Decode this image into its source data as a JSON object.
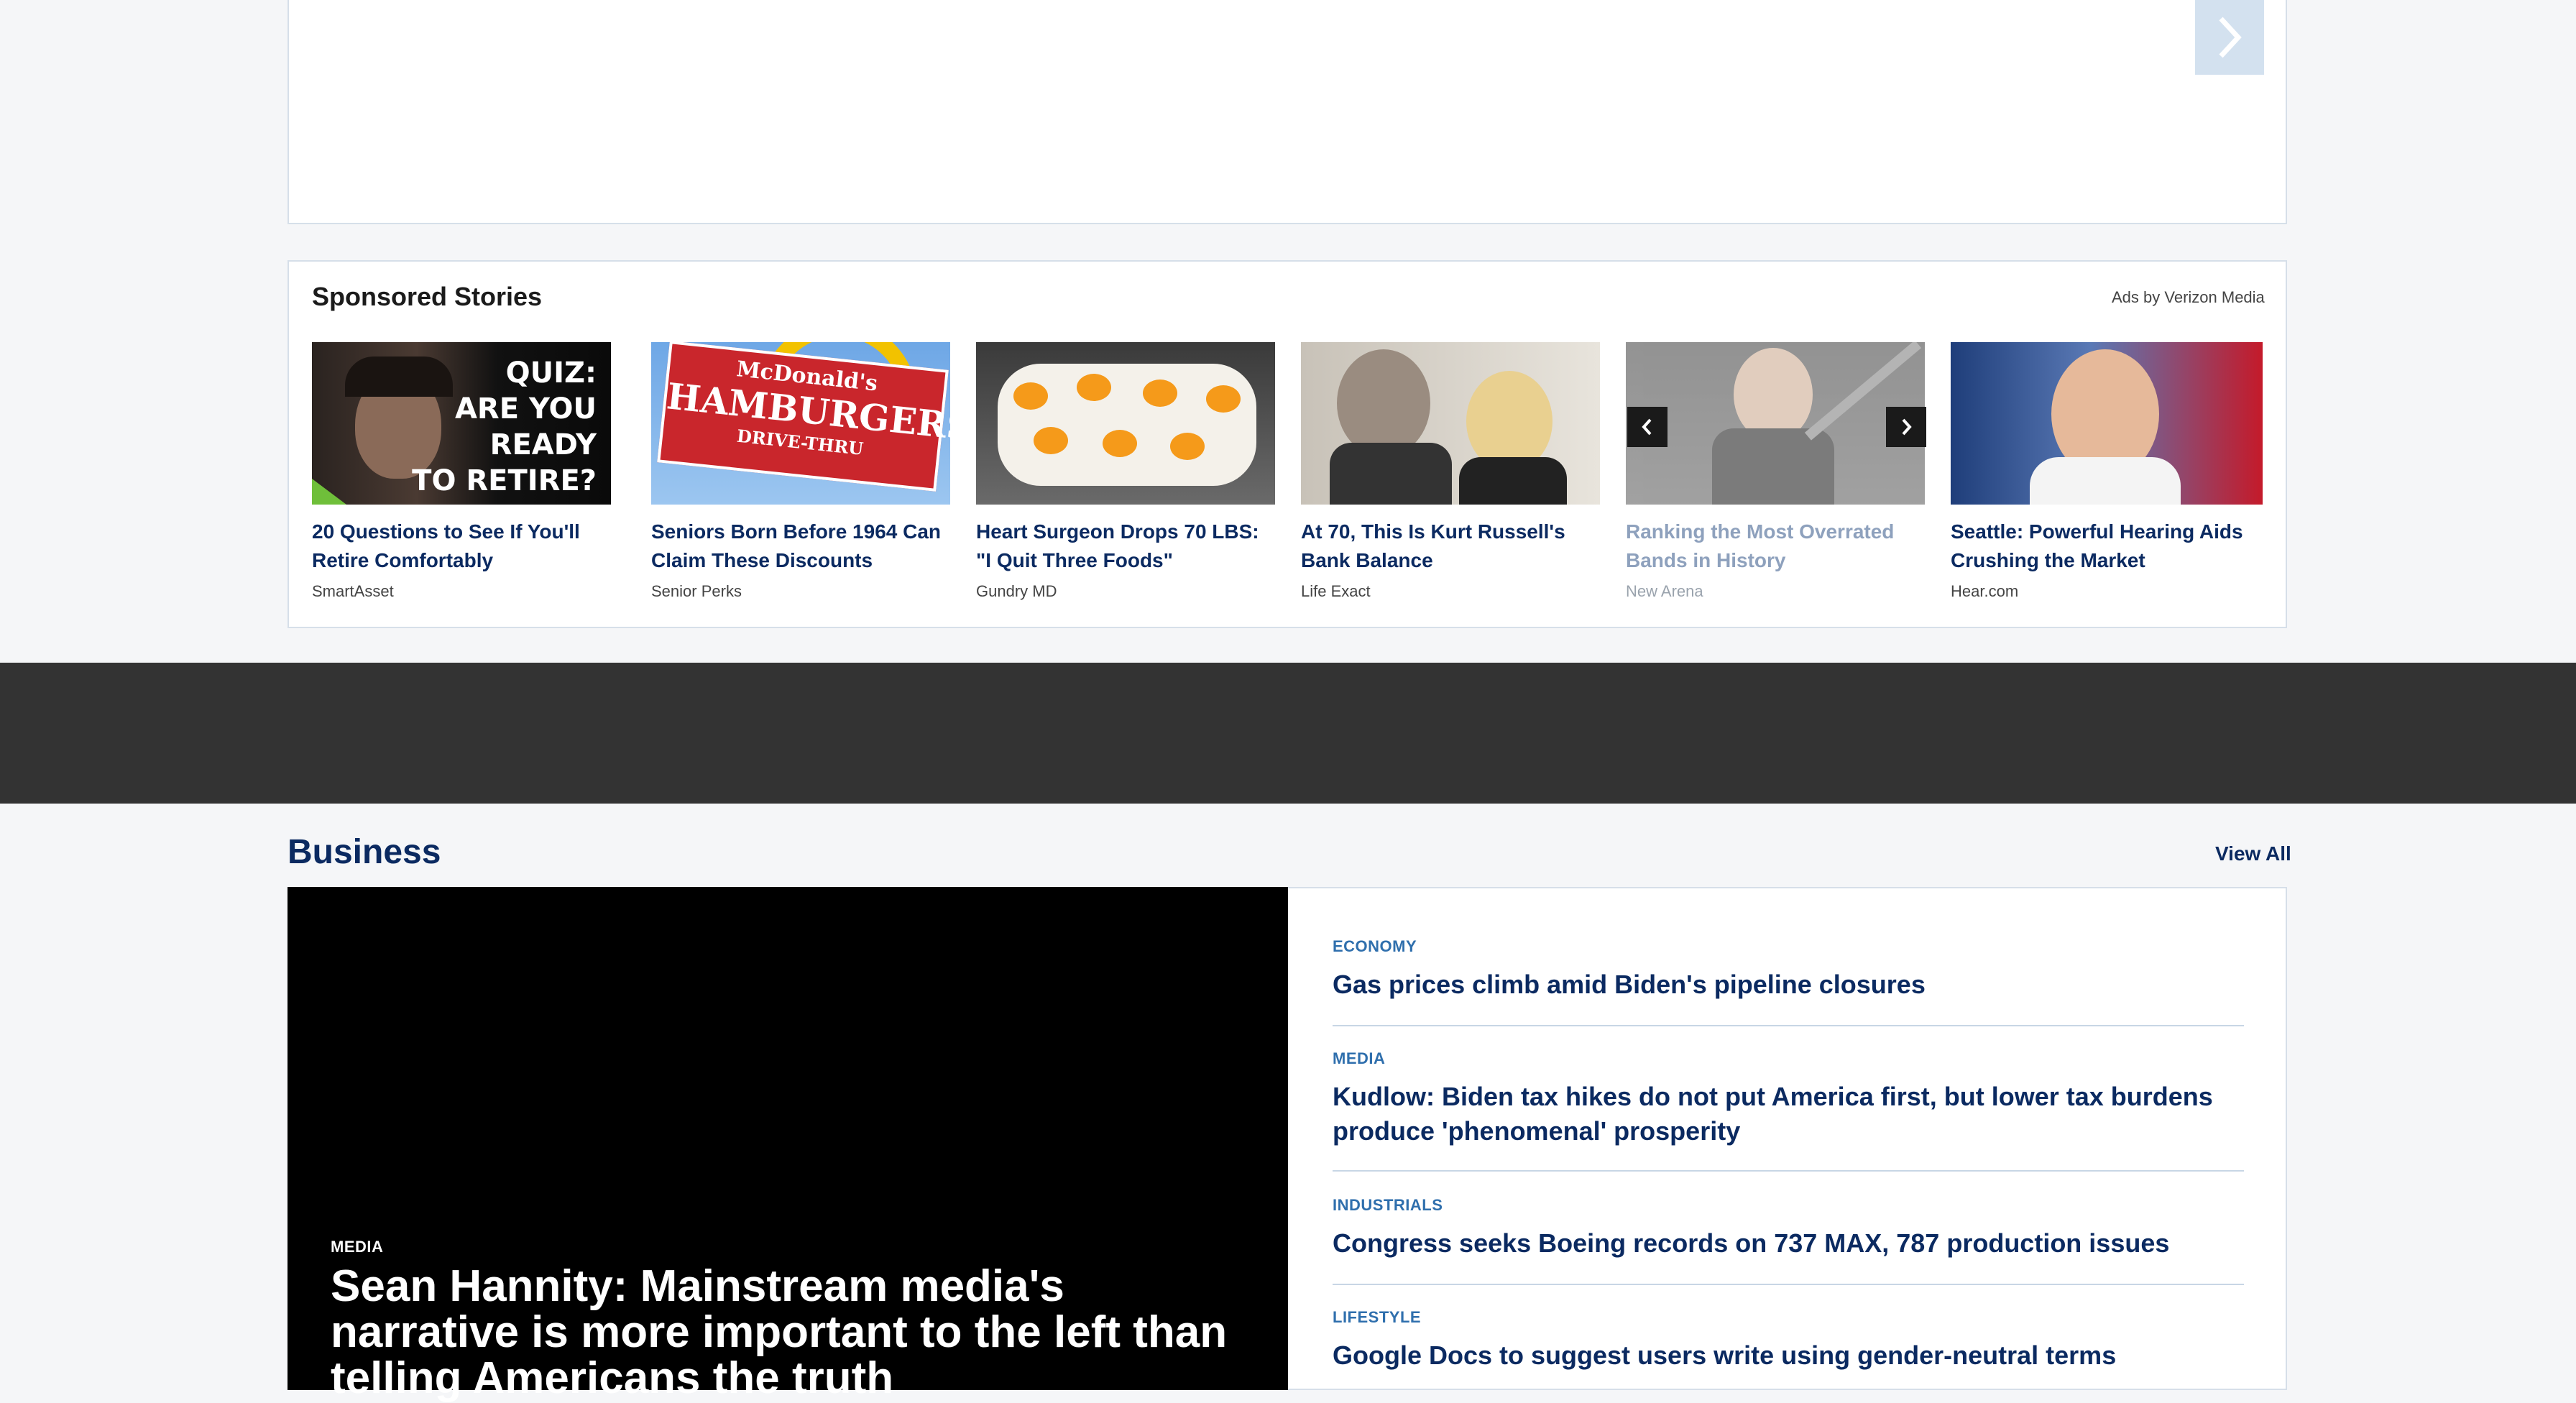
{
  "sponsored": {
    "title": "Sponsored Stories",
    "ads_label": "Ads by Verizon Media",
    "cards": [
      {
        "title": "20 Questions to See If You'll Retire Comfortably",
        "source": "SmartAsset",
        "overlay_lines": [
          "QUIZ:",
          "ARE YOU",
          "READY",
          "TO RETIRE?"
        ]
      },
      {
        "title": "Seniors Born Before 1964 Can Claim These Discounts",
        "source": "Senior Perks",
        "sign_top": "McDonald's",
        "sign_main": "HAMBURGERS",
        "sign_bottom": "DRIVE-THRU"
      },
      {
        "title": "Heart Surgeon Drops 70 LBS: \"I Quit Three Foods\"",
        "source": "Gundry MD"
      },
      {
        "title": "At 70, This Is Kurt Russell's Bank Balance",
        "source": "Life Exact"
      },
      {
        "title": "Ranking the Most Overrated Bands in History",
        "source": "New Arena"
      },
      {
        "title": "Seattle: Powerful Hearing Aids Crushing the Market",
        "source": "Hear.com"
      }
    ]
  },
  "business": {
    "title": "Business",
    "view_all": "View All",
    "hero": {
      "category": "MEDIA",
      "title": "Sean Hannity: Mainstream media's narrative is more important to the left than telling Americans the truth"
    },
    "items": [
      {
        "category": "ECONOMY",
        "title": "Gas prices climb amid Biden's pipeline closures"
      },
      {
        "category": "MEDIA",
        "title": "Kudlow: Biden tax hikes do not put America first, but lower tax burdens produce 'phenomenal' prosperity"
      },
      {
        "category": "INDUSTRIALS",
        "title": "Congress seeks Boeing records on 737 MAX, 787 production issues"
      },
      {
        "category": "LIFESTYLE",
        "title": "Google Docs to suggest users write using gender-neutral terms"
      }
    ]
  },
  "icons": {
    "top_next": "chevron-right-icon",
    "prev": "chevron-left-icon",
    "next": "chevron-right-icon"
  },
  "colors": {
    "navy": "#0b2a61",
    "category_blue": "#2f6fad",
    "dark_band": "#333333"
  }
}
